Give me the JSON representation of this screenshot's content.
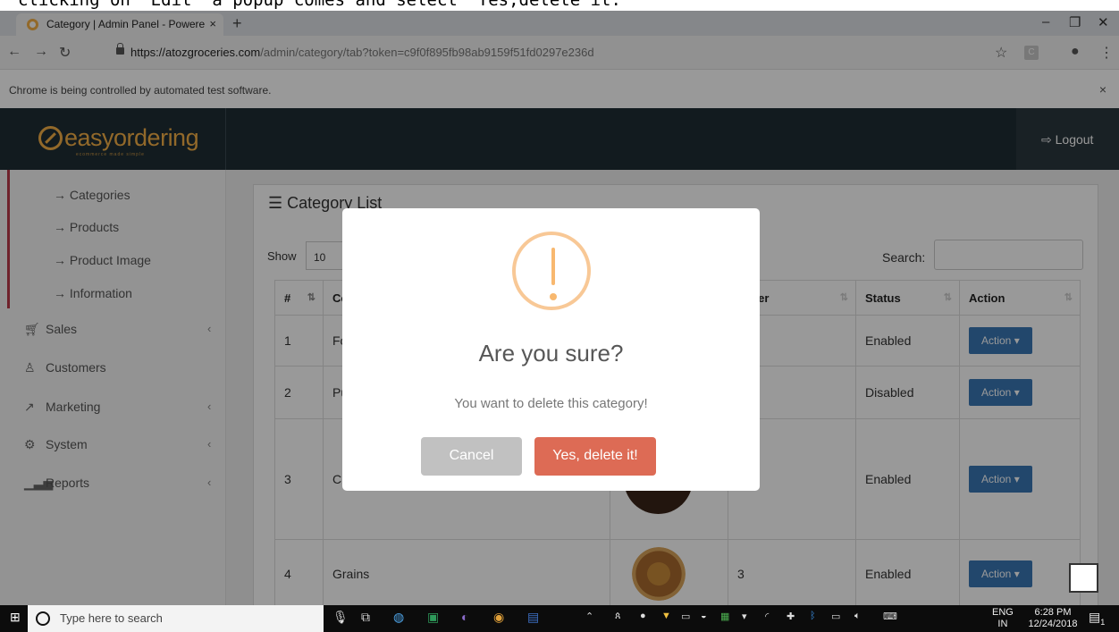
{
  "annotation": "clicking on \"Edit\" a popup comes and select \"Yes,delete it.\"",
  "browser": {
    "tab_title": "Category | Admin Panel - Powere",
    "tab_close": "×",
    "new_tab": "+",
    "url_host": "https://atozgroceries.com",
    "url_path": "/admin/category/tab?token=c9f0f895fb98ab9159f51fd0297e236d",
    "infobar_text": "Chrome is being controlled by automated test software.",
    "infobar_close": "×",
    "ext_letter": "C"
  },
  "header": {
    "logo_text": "easyordering",
    "logo_tagline": "ecommerce made simple",
    "logout_label": "Logout"
  },
  "sidebar": {
    "sub_items": [
      {
        "label": "Categories"
      },
      {
        "label": "Products"
      },
      {
        "label": "Product Image"
      },
      {
        "label": "Information"
      }
    ],
    "items": [
      {
        "label": "Sales",
        "icon": "cart-icon"
      },
      {
        "label": "Customers",
        "icon": "user-icon"
      },
      {
        "label": "Marketing",
        "icon": "share-icon"
      },
      {
        "label": "System",
        "icon": "gear-icon"
      },
      {
        "label": "Reports",
        "icon": "bar-chart-icon"
      }
    ]
  },
  "panel": {
    "title": "Category List",
    "show_label": "Show",
    "show_value": "10",
    "search_label": "Search:",
    "columns": [
      "#",
      "Co",
      "",
      "Order",
      "Status",
      "Action"
    ],
    "rows": [
      {
        "num": "1",
        "name": "Fo",
        "order": "",
        "status": "Enabled",
        "action": "Action"
      },
      {
        "num": "2",
        "name": "Pu",
        "order": "",
        "status": "Disabled",
        "action": "Action"
      },
      {
        "num": "3",
        "name": "Ch",
        "order": "",
        "status": "Enabled",
        "action": "Action"
      },
      {
        "num": "4",
        "name": "Grains",
        "order": "3",
        "status": "Enabled",
        "action": "Action"
      }
    ]
  },
  "modal": {
    "title": "Are you sure?",
    "text": "You want to delete this category!",
    "cancel_label": "Cancel",
    "confirm_label": "Yes, delete it!"
  },
  "taskbar": {
    "search_placeholder": "Type here to search",
    "lang": "ENG",
    "lang2": "IN",
    "time": "6:28 PM",
    "date": "12/24/2018",
    "notification_count": "1"
  },
  "colors": {
    "header_bg": "#1f2d35",
    "logo": "#f4b046",
    "action_button": "#3977b5",
    "confirm_button": "#dd6b55",
    "cancel_button": "#c1c1c1",
    "warning_icon": "#f8c896"
  }
}
